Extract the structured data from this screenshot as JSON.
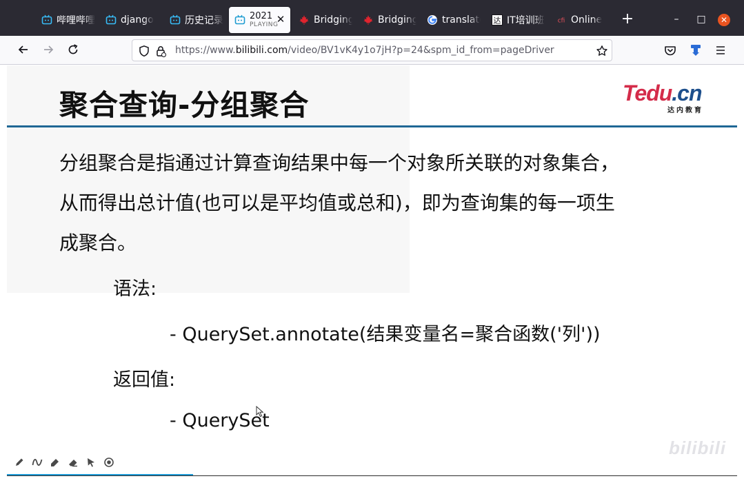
{
  "browser": {
    "tabs": [
      {
        "label": "哔哩哔哩",
        "icon": "bilibili-tv-icon"
      },
      {
        "label": "django",
        "icon": "bilibili-tv-icon"
      },
      {
        "label": "历史记录",
        "icon": "bilibili-tv-icon"
      },
      {
        "label": "2021",
        "sublabel": "PLAYING",
        "icon": "bilibili-tv-icon",
        "active": true
      },
      {
        "label": "Bridging",
        "icon": "maple-leaf-icon"
      },
      {
        "label": "Bridging",
        "icon": "maple-leaf-icon"
      },
      {
        "label": "translate",
        "icon": "google-icon"
      },
      {
        "label": "IT培训班",
        "icon": "tarena-icon"
      },
      {
        "label": "Online",
        "icon": "cfi-icon"
      }
    ],
    "window_controls": {
      "minimize": "–",
      "maximize": "□",
      "close": "✕"
    },
    "url": {
      "prefix": "https://www.",
      "domain": "bilibili.com",
      "path": "/video/BV1vK4y1o7jH?p=24&spm_id_from=pageDriver"
    }
  },
  "slide": {
    "title": "聚合查询-分组聚合",
    "logo": {
      "main_a": "Tedu",
      "main_b": ".cn",
      "sub": "达内教育"
    },
    "body_lines": [
      "分组聚合是指通过计算查询结果中每一个对象所关联的对象集合，",
      "从而得出总计值(也可以是平均值或总和)，即为查询集的每一项生",
      "成聚合。"
    ],
    "syntax_label": "语法:",
    "syntax_line": "- QuerySet.annotate(结果变量名=聚合函数('列'))",
    "return_label": "返回值:",
    "return_line": "- QuerySet"
  },
  "player": {
    "watermark": "bilibili",
    "draw_tools": [
      "pen-icon",
      "curve-icon",
      "highlighter-icon",
      "eraser-icon",
      "pointer-icon",
      "record-icon"
    ]
  },
  "colors": {
    "accent": "#1f6795",
    "logo_red": "#d42c4a",
    "logo_blue": "#1d4f8c",
    "progress": "#1f9ad6"
  }
}
